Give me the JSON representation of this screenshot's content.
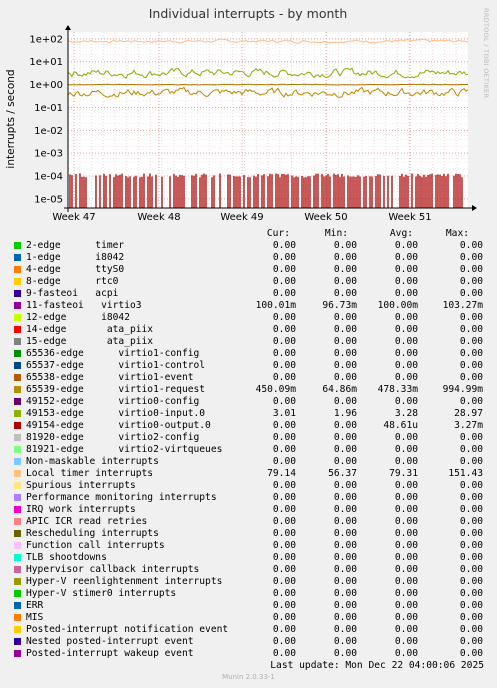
{
  "chart_data": {
    "type": "line",
    "title": "Individual interrupts - by month",
    "ylabel": "interrupts / second",
    "yscale": "log",
    "ylim": [
      4e-06,
      200
    ],
    "y_ticks": [
      {
        "value": 100,
        "label": "1e+02"
      },
      {
        "value": 10,
        "label": "1e+01"
      },
      {
        "value": 1,
        "label": "1e+00"
      },
      {
        "value": 0.1,
        "label": "1e-01"
      },
      {
        "value": 0.01,
        "label": "1e-02"
      },
      {
        "value": 0.001,
        "label": "1e-03"
      },
      {
        "value": 0.0001,
        "label": "1e-04"
      },
      {
        "value": 1e-05,
        "label": "1e-05"
      }
    ],
    "x_ticks": [
      "Week 47",
      "Week 48",
      "Week 49",
      "Week 50",
      "Week 51"
    ],
    "side_label": "RRDTOOL / TOBI OETIKER",
    "series_drawn": [
      {
        "name": "Local timer interrupts",
        "color": "#ffbb88",
        "level": 79.3
      },
      {
        "name": "49153-edge virtio0-input.0",
        "color": "#88aa00",
        "level": 3.3
      },
      {
        "name": "11-fasteoi virtio3",
        "color": "#aa7700",
        "level": 1.0
      },
      {
        "name": "65539-edge virtio1-request",
        "color": "#bb8800",
        "level": 0.45
      },
      {
        "name": "49154-edge virtio0-output.0",
        "color": "#aa0000",
        "level": 4.86e-05
      }
    ],
    "series": [
      {
        "name": "2-edge      timer",
        "color": "#00cc00",
        "cur": "0.00",
        "min": "0.00",
        "avg": "0.00",
        "max": "0.00"
      },
      {
        "name": "1-edge      i8042",
        "color": "#0066b3",
        "cur": "0.00",
        "min": "0.00",
        "avg": "0.00",
        "max": "0.00"
      },
      {
        "name": "4-edge      ttyS0",
        "color": "#ff8000",
        "cur": "0.00",
        "min": "0.00",
        "avg": "0.00",
        "max": "0.00"
      },
      {
        "name": "8-edge      rtc0",
        "color": "#ffcc00",
        "cur": "0.00",
        "min": "0.00",
        "avg": "0.00",
        "max": "0.00"
      },
      {
        "name": "9-fasteoi   acpi",
        "color": "#330099",
        "cur": "0.00",
        "min": "0.00",
        "avg": "0.00",
        "max": "0.00"
      },
      {
        "name": "11-fasteoi   virtio3",
        "color": "#990099",
        "cur": "100.01m",
        "min": "96.73m",
        "avg": "100.00m",
        "max": "103.27m"
      },
      {
        "name": "12-edge      i8042",
        "color": "#ccff00",
        "cur": "0.00",
        "min": "0.00",
        "avg": "0.00",
        "max": "0.00"
      },
      {
        "name": "14-edge       ata_piix",
        "color": "#ff0000",
        "cur": "0.00",
        "min": "0.00",
        "avg": "0.00",
        "max": "0.00"
      },
      {
        "name": "15-edge       ata_piix",
        "color": "#808080",
        "cur": "0.00",
        "min": "0.00",
        "avg": "0.00",
        "max": "0.00"
      },
      {
        "name": "65536-edge      virtio1-config",
        "color": "#008f00",
        "cur": "0.00",
        "min": "0.00",
        "avg": "0.00",
        "max": "0.00"
      },
      {
        "name": "65537-edge      virtio1-control",
        "color": "#00487d",
        "cur": "0.00",
        "min": "0.00",
        "avg": "0.00",
        "max": "0.00"
      },
      {
        "name": "65538-edge      virtio1-event",
        "color": "#b35a00",
        "cur": "0.00",
        "min": "0.00",
        "avg": "0.00",
        "max": "0.00"
      },
      {
        "name": "65539-edge      virtio1-request",
        "color": "#b38f00",
        "cur": "450.09m",
        "min": "64.86m",
        "avg": "478.33m",
        "max": "994.99m"
      },
      {
        "name": "49152-edge      virtio0-config",
        "color": "#6b006b",
        "cur": "0.00",
        "min": "0.00",
        "avg": "0.00",
        "max": "0.00"
      },
      {
        "name": "49153-edge      virtio0-input.0",
        "color": "#8fb300",
        "cur": "3.01",
        "min": "1.96",
        "avg": "3.28",
        "max": "28.97"
      },
      {
        "name": "49154-edge      virtio0-output.0",
        "color": "#b30000",
        "cur": "0.00",
        "min": "0.00",
        "avg": "48.61u",
        "max": "3.27m"
      },
      {
        "name": "81920-edge      virtio2-config",
        "color": "#bebebe",
        "cur": "0.00",
        "min": "0.00",
        "avg": "0.00",
        "max": "0.00"
      },
      {
        "name": "81921-edge      virtio2-virtqueues",
        "color": "#80ff80",
        "cur": "0.00",
        "min": "0.00",
        "avg": "0.00",
        "max": "0.00"
      },
      {
        "name": "Non-maskable interrupts",
        "color": "#80c9ff",
        "cur": "0.00",
        "min": "0.00",
        "avg": "0.00",
        "max": "0.00"
      },
      {
        "name": "Local timer interrupts",
        "color": "#ffc080",
        "cur": "79.14",
        "min": "56.37",
        "avg": "79.31",
        "max": "151.43"
      },
      {
        "name": "Spurious interrupts",
        "color": "#ffe680",
        "cur": "0.00",
        "min": "0.00",
        "avg": "0.00",
        "max": "0.00"
      },
      {
        "name": "Performance monitoring interrupts",
        "color": "#aa80ff",
        "cur": "0.00",
        "min": "0.00",
        "avg": "0.00",
        "max": "0.00"
      },
      {
        "name": "IRQ work interrupts",
        "color": "#ee00cc",
        "cur": "0.00",
        "min": "0.00",
        "avg": "0.00",
        "max": "0.00"
      },
      {
        "name": "APIC ICR read retries",
        "color": "#ff8080",
        "cur": "0.00",
        "min": "0.00",
        "avg": "0.00",
        "max": "0.00"
      },
      {
        "name": "Rescheduling interrupts",
        "color": "#666600",
        "cur": "0.00",
        "min": "0.00",
        "avg": "0.00",
        "max": "0.00"
      },
      {
        "name": "Function call interrupts",
        "color": "#ffbfff",
        "cur": "0.00",
        "min": "0.00",
        "avg": "0.00",
        "max": "0.00"
      },
      {
        "name": "TLB shootdowns",
        "color": "#00ffcc",
        "cur": "0.00",
        "min": "0.00",
        "avg": "0.00",
        "max": "0.00"
      },
      {
        "name": "Hypervisor callback interrupts",
        "color": "#cc6699",
        "cur": "0.00",
        "min": "0.00",
        "avg": "0.00",
        "max": "0.00"
      },
      {
        "name": "Hyper-V reenlightenment interrupts",
        "color": "#999900",
        "cur": "0.00",
        "min": "0.00",
        "avg": "0.00",
        "max": "0.00"
      },
      {
        "name": "Hyper-V stimer0 interrupts",
        "color": "#00cc00",
        "cur": "0.00",
        "min": "0.00",
        "avg": "0.00",
        "max": "0.00"
      },
      {
        "name": "ERR",
        "color": "#0066b3",
        "cur": "0.00",
        "min": "0.00",
        "avg": "0.00",
        "max": "0.00"
      },
      {
        "name": "MIS",
        "color": "#ff8000",
        "cur": "0.00",
        "min": "0.00",
        "avg": "0.00",
        "max": "0.00"
      },
      {
        "name": "Posted-interrupt notification event",
        "color": "#ffcc00",
        "cur": "0.00",
        "min": "0.00",
        "avg": "0.00",
        "max": "0.00"
      },
      {
        "name": "Nested posted-interrupt event",
        "color": "#330099",
        "cur": "0.00",
        "min": "0.00",
        "avg": "0.00",
        "max": "0.00"
      },
      {
        "name": "Posted-interrupt wakeup event",
        "color": "#990099",
        "cur": "0.00",
        "min": "0.00",
        "avg": "0.00",
        "max": "0.00"
      }
    ]
  },
  "legend_headers": {
    "cur": "Cur:",
    "min": "Min:",
    "avg": "Avg:",
    "max": "Max:"
  },
  "footer": {
    "last_update": "Last update:  Mon Dec 22 04:00:06 2025",
    "version": "Munin 2.0.33-1"
  }
}
